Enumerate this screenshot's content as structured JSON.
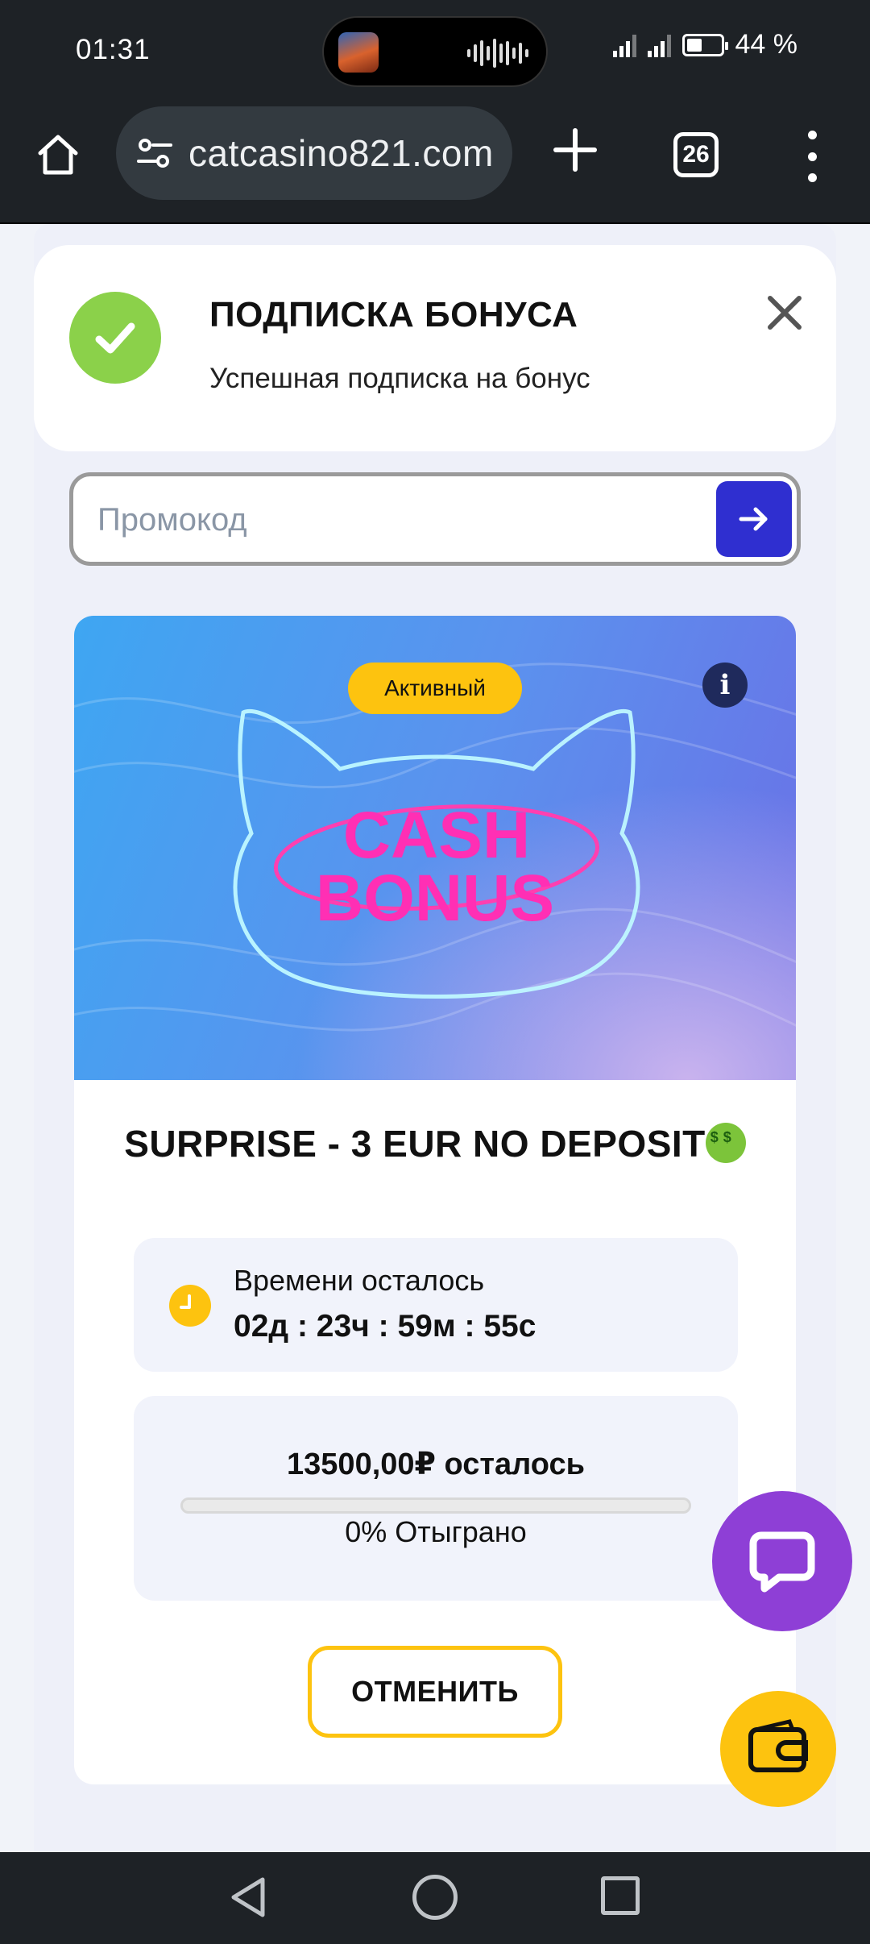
{
  "status_bar": {
    "time": "01:31",
    "battery_text": "44 %",
    "battery_level": 0.44
  },
  "browser": {
    "url": "catcasino821.com",
    "tab_count": "26"
  },
  "toast": {
    "title": "ПОДПИСКА БОНУСА",
    "message": "Успешная подписка на бонус",
    "icon": "check-icon",
    "accent": "#8bd14a"
  },
  "promo": {
    "placeholder": "Промокод",
    "value": ""
  },
  "bonus": {
    "status_badge": "Активный",
    "title": "SURPRISE - 3 EUR NO DEPOSIT",
    "timer_label": "Времени осталось",
    "timer_value": "02д : 23ч : 59м : 55с",
    "wager_remaining": "13500,00₽ осталось",
    "wager_played": "0% Отыграно",
    "progress_fraction": 0,
    "cancel_label": "ОТМЕНИТЬ",
    "banner_text_line1": "CASH",
    "banner_text_line2": "BONUS"
  },
  "colors": {
    "brand_yellow": "#fdc30f",
    "brand_blue": "#2f2fd0",
    "chat_purple": "#8e3fd6"
  }
}
